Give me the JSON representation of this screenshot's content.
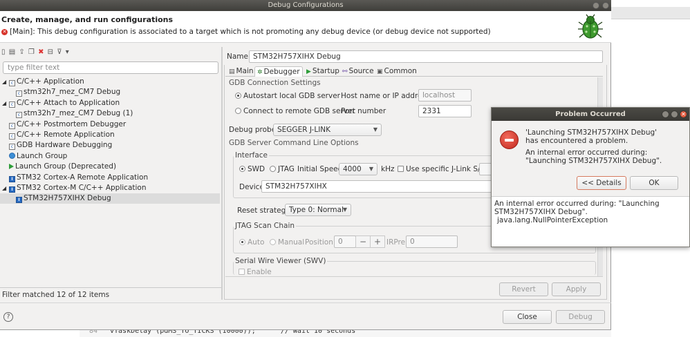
{
  "window": {
    "title": "Debug Configurations",
    "header_title": "Create, manage, and run configurations",
    "header_error": "[Main]: This debug configuration is associated to a target which is not promoting any debug device (or debug device not supported)"
  },
  "left": {
    "filter_placeholder": "type filter text",
    "tree": [
      {
        "label": "C/C++ Application",
        "level": 0,
        "expanded": true,
        "icon": "c-app-icon"
      },
      {
        "label": "stm32h7_mez_CM7 Debug",
        "level": 1,
        "icon": "c-app-icon"
      },
      {
        "label": "C/C++ Attach to Application",
        "level": 0,
        "expanded": true,
        "icon": "c-app-icon"
      },
      {
        "label": "stm32h7_mez_CM7 Debug (1)",
        "level": 1,
        "icon": "c-app-icon"
      },
      {
        "label": "C/C++ Postmortem Debugger",
        "level": 0,
        "icon": "c-app-icon"
      },
      {
        "label": "C/C++ Remote Application",
        "level": 0,
        "icon": "c-app-icon"
      },
      {
        "label": "GDB Hardware Debugging",
        "level": 0,
        "icon": "c-app-icon"
      },
      {
        "label": "Launch Group",
        "level": 0,
        "icon": "launch-group-icon"
      },
      {
        "label": "Launch Group (Deprecated)",
        "level": 0,
        "icon": "launch-group-deprecated-icon"
      },
      {
        "label": "STM32 Cortex-A Remote Application",
        "level": 0,
        "icon": "ide-icon"
      },
      {
        "label": "STM32 Cortex-M C/C++ Application",
        "level": 0,
        "expanded": true,
        "icon": "ide-icon"
      },
      {
        "label": "STM32H757XIHX Debug",
        "level": 1,
        "icon": "ide-icon",
        "selected": true
      }
    ],
    "filter_status": "Filter matched 12 of 12 items"
  },
  "config": {
    "name_label": "Name:",
    "name_value": "STM32H757XIHX Debug",
    "tabs": [
      {
        "label": "Main",
        "icon": "main-tab-icon"
      },
      {
        "label": "Debugger",
        "icon": "debugger-tab-icon",
        "active": true
      },
      {
        "label": "Startup",
        "icon": "startup-tab-icon"
      },
      {
        "label": "Source",
        "icon": "source-tab-icon"
      },
      {
        "label": "Common",
        "icon": "common-tab-icon"
      }
    ],
    "gdb_conn": {
      "title": "GDB Connection Settings",
      "autostart_label": "Autostart local GDB server",
      "remote_label": "Connect to remote GDB server",
      "host_label": "Host name or IP address",
      "host_value": "localhost",
      "port_label": "Port number",
      "port_value": "2331"
    },
    "debug_probe_label": "Debug probe",
    "debug_probe_value": "SEGGER J-LINK",
    "gdb_server_title": "GDB Server Command Line Options",
    "interface": {
      "title": "Interface",
      "swd_label": "SWD",
      "jtag_label": "JTAG",
      "speed_label": "Initial Speed",
      "speed_value": "4000",
      "khz_label": "kHz",
      "jlink_sn_label": "Use specific J-Link S/N",
      "device_label": "Device",
      "device_value": "STM32H757XIHX"
    },
    "reset_label": "Reset strategy",
    "reset_value": "Type 0: Normal",
    "jtag_scan": {
      "title": "JTAG Scan Chain",
      "auto_label": "Auto",
      "manual_label": "Manual",
      "position_label": "Position",
      "position_value": "0",
      "irpre_label": "IRPre",
      "irpre_value": "0"
    },
    "swv": {
      "title": "Serial Wire Viewer (SWV)",
      "enable_label": "Enable"
    },
    "revert_label": "Revert",
    "apply_label": "Apply"
  },
  "footer": {
    "close_label": "Close",
    "debug_label": "Debug",
    "help_label": "?"
  },
  "dialog": {
    "title": "Problem Occurred",
    "message1": "'Launching STM32H757XIHX Debug' has encountered a problem.",
    "message2": "An internal error occurred during: \"Launching STM32H757XIHX Debug\".",
    "details_label": "<< Details",
    "ok_label": "OK",
    "details_line1": "An internal error occurred during: \"Launching STM32H757XIHX Debug\".",
    "details_line2": "java.lang.NullPointerException"
  },
  "background": {
    "code_line_number": "84",
    "code_text": "vTaskDelay (pdMS_TO_TICKS (10000));      // Wait 10 seconds"
  },
  "colors": {
    "title_bar": "#3f3e3a",
    "error_red": "#d7322a",
    "ide_blue": "#2a6cc2",
    "selection": "#dcdcdc"
  }
}
